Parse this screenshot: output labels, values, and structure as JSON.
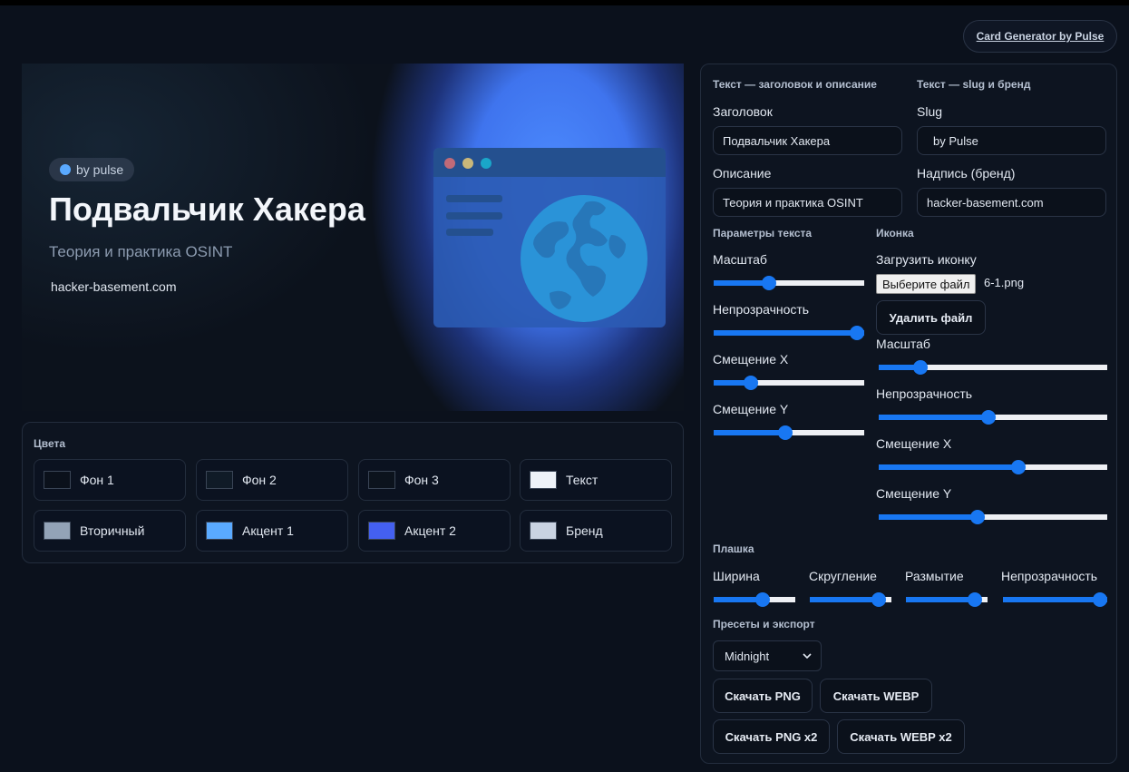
{
  "header": {
    "link_label": "Card Generator by Pulse"
  },
  "preview": {
    "badge_text": "by pulse",
    "title": "Подвальчик Хакера",
    "subtitle": "Теория и практика OSINT",
    "brand": "hacker-basement.com"
  },
  "colors": {
    "title": "Цвета",
    "items": [
      {
        "label": "Фон 1",
        "color": "#0b111b"
      },
      {
        "label": "Фон 2",
        "color": "#101b27"
      },
      {
        "label": "Фон 3",
        "color": "#0c131d"
      },
      {
        "label": "Текст",
        "color": "#eef2f8"
      },
      {
        "label": "Вторичный",
        "color": "#93a3b7"
      },
      {
        "label": "Акцент 1",
        "color": "#5aaaff"
      },
      {
        "label": "Акцент 2",
        "color": "#4460f0"
      },
      {
        "label": "Бренд",
        "color": "#c9d3e2"
      }
    ]
  },
  "text_section": {
    "title": "Текст — заголовок и описание",
    "title_label": "Заголовок",
    "title_value": "Подвальчик Хакера",
    "desc_label": "Описание",
    "desc_value": "Теория и практика OSINT"
  },
  "slug_section": {
    "title": "Текст — slug и бренд",
    "slug_label": "Slug",
    "slug_value": "by Pulse",
    "brand_label": "Надпись (бренд)",
    "brand_value": "hacker-basement.com"
  },
  "text_params": {
    "title": "Параметры текста",
    "scale_label": "Масштаб",
    "scale_value": 35,
    "opacity_label": "Непрозрачность",
    "opacity_value": 100,
    "offset_x_label": "Смещение X",
    "offset_x_value": 22,
    "offset_y_label": "Смещение Y",
    "offset_y_value": 47
  },
  "icon": {
    "title": "Иконка",
    "upload_label": "Загрузить иконку",
    "choose_file_label": "Выберите файл",
    "file_name": "6-1.png",
    "delete_label": "Удалить файл",
    "scale_label": "Масштаб",
    "scale_value": 16,
    "opacity_label": "Непрозрачность",
    "opacity_value": 48,
    "offset_x_label": "Смещение X",
    "offset_x_value": 62,
    "offset_y_label": "Смещение Y",
    "offset_y_value": 43
  },
  "plate": {
    "title": "Плашка",
    "width_label": "Ширина",
    "width_value": 62,
    "radius_label": "Скругление",
    "radius_value": 92,
    "blur_label": "Размытие",
    "blur_value": 92,
    "opacity_label": "Непрозрачность",
    "opacity_value": 100
  },
  "export": {
    "title": "Пресеты и экспорт",
    "preset_selected": "Midnight",
    "png_label": "Скачать PNG",
    "webp_label": "Скачать WEBP",
    "png2_label": "Скачать PNG x2",
    "webp2_label": "Скачать WEBP x2"
  }
}
